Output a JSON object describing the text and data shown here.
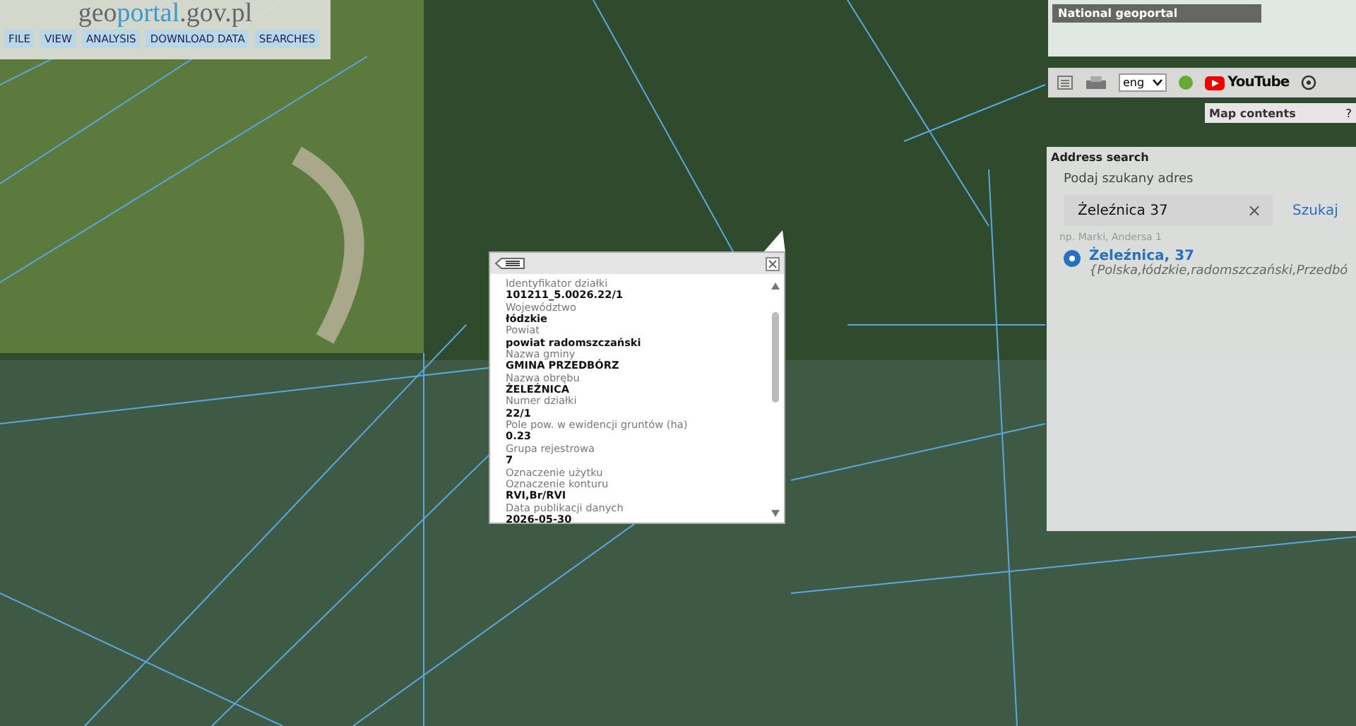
{
  "header": {
    "logo_prefix": "geo",
    "logo_main": "portal",
    "logo_suffix": ".gov.pl",
    "menu": [
      {
        "label": "FILE"
      },
      {
        "label": "VIEW"
      },
      {
        "label": "ANALYSIS"
      },
      {
        "label": "DOWNLOAD DATA"
      },
      {
        "label": "SEARCHES"
      }
    ]
  },
  "minimap": {
    "title": "National geoportal"
  },
  "toolbar": {
    "language": "eng",
    "youtube_label": "YouTube"
  },
  "map_contents": {
    "title": "Map contents",
    "help": "?"
  },
  "address_search": {
    "title": "Address search",
    "prompt": "Podaj szukany adres",
    "query": "Żeleźnica 37",
    "clear": "×",
    "button": "Szukaj",
    "hint": "np. Marki, Andersa 1",
    "results": [
      {
        "name": "Żeleźnica, 37",
        "detail": "{Polska,łódzkie,radomszczański,Przedbó",
        "selected": true
      }
    ]
  },
  "popup": {
    "fields": [
      {
        "kind": "label",
        "text": "Identyfikator działki"
      },
      {
        "kind": "value",
        "text": "101211_5.0026.22/1"
      },
      {
        "kind": "label",
        "text": "Województwo"
      },
      {
        "kind": "value",
        "text": "łódzkie"
      },
      {
        "kind": "label",
        "text": "Powiat"
      },
      {
        "kind": "value",
        "text": "powiat radomszczański"
      },
      {
        "kind": "label",
        "text": "Nazwa gminy"
      },
      {
        "kind": "value",
        "text": "GMINA PRZEDBÓRZ"
      },
      {
        "kind": "label",
        "text": "Nazwa obrębu"
      },
      {
        "kind": "value",
        "text": "ŻELEŹNICA"
      },
      {
        "kind": "label",
        "text": "Numer działki"
      },
      {
        "kind": "value",
        "text": "22/1"
      },
      {
        "kind": "label",
        "text": "Pole pow. w ewidencji gruntów (ha)"
      },
      {
        "kind": "value",
        "text": "0.23"
      },
      {
        "kind": "label",
        "text": "Grupa rejestrowa"
      },
      {
        "kind": "value",
        "text": "7"
      },
      {
        "kind": "label",
        "text": "Oznaczenie użytku"
      },
      {
        "kind": "label",
        "text": "Oznaczenie konturu"
      },
      {
        "kind": "value",
        "text": "RVI,Br/RVI"
      },
      {
        "kind": "label",
        "text": "Data publikacji danych"
      },
      {
        "kind": "value",
        "text": "2026-05-30"
      }
    ]
  }
}
